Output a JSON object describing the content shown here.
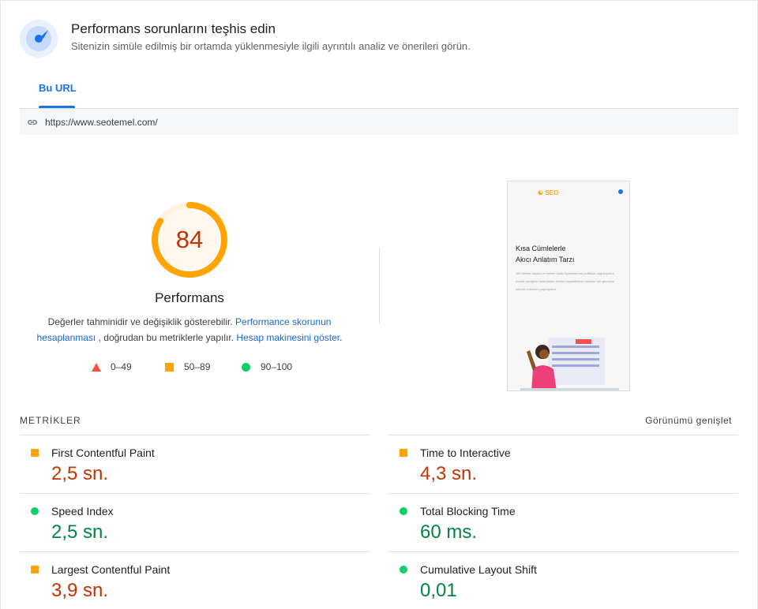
{
  "header": {
    "title": "Performans sorunlarını teşhis edin",
    "subtitle": "Sitenizin simüle edilmiş bir ortamda yüklenmesiyle ilgili ayrıntılı analiz ve önerileri görün."
  },
  "tabs": [
    {
      "label": "Bu URL",
      "active": true
    }
  ],
  "url_bar": {
    "url": "https://www.seotemel.com/"
  },
  "score": {
    "value": "84",
    "fraction": 0.84,
    "label": "Performans",
    "color": "#ffa400"
  },
  "description": {
    "text_1": "Değerler tahminidir ve değişiklik gösterebilir. ",
    "link_1": "Performance skorunun hesaplanması",
    "text_2": " , doğrudan bu metriklerle yapılır. ",
    "link_2": "Hesap makinesini göster",
    "text_3": "."
  },
  "legend": [
    {
      "range": "0–49",
      "shape": "triangle",
      "color": "#ff4e42"
    },
    {
      "range": "50–89",
      "shape": "square",
      "color": "#ffa400"
    },
    {
      "range": "90–100",
      "shape": "circle",
      "color": "#0cce6b"
    }
  ],
  "thumbnail": {
    "logo": "SEO",
    "heading_line_1": "Kısa Cümlelerle",
    "heading_line_2": "Akıcı Anlatım Tarzı",
    "body": "150 kelime başına ve kelime kalıbı fiyatlandırma politikası uyguluyoruz. Ancak içeriğinizi hazırlarken kelime kapasitesinin dolması için gereksiz sözcük kullanımı yapmıyoruz."
  },
  "metrics": {
    "title": "METRİKLER",
    "toggle": "Görünümü genişlet",
    "items": [
      {
        "label": "First Contentful Paint",
        "value": "2,5 sn.",
        "status": "orange"
      },
      {
        "label": "Time to Interactive",
        "value": "4,3 sn.",
        "status": "orange"
      },
      {
        "label": "Speed Index",
        "value": "2,5 sn.",
        "status": "green"
      },
      {
        "label": "Total Blocking Time",
        "value": "60 ms.",
        "status": "green"
      },
      {
        "label": "Largest Contentful Paint",
        "value": "3,9 sn.",
        "status": "orange"
      },
      {
        "label": "Cumulative Layout Shift",
        "value": "0,01",
        "status": "green"
      }
    ]
  }
}
